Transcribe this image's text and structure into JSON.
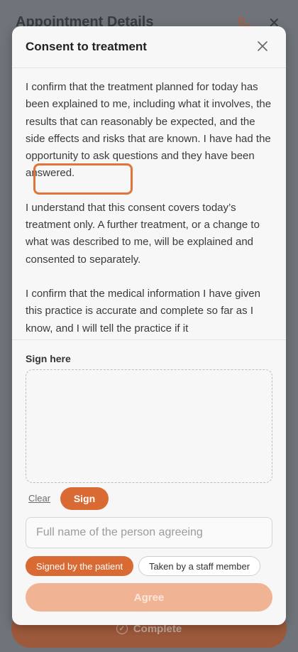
{
  "background": {
    "title": "Appointment Details",
    "complete_label": "Complete",
    "icons": {
      "phone": "phone-icon",
      "close": "close-icon",
      "check": "check-circle-icon"
    }
  },
  "modal": {
    "title": "Consent to treatment",
    "close_icon": "close-icon",
    "paragraphs": [
      "I confirm that the treatment planned for today has been explained to me, including what it involves, the results that can reasonably be expected, and the side effects and risks that are known. I have had the opportunity to ask questions and they have been answered.",
      "I understand that this consent covers today’s treatment only. A further treatment, or a change to what was described to me, will be explained and consented to separately.",
      "I confirm that the medical information I have given this practice is accurate and complete so far as I know, and I will tell the practice if it"
    ],
    "signature": {
      "label": "Sign here",
      "clear_label": "Clear",
      "sign_label": "Sign"
    },
    "name_field": {
      "placeholder": "Full name of the person agreeing",
      "value": ""
    },
    "signer_options": [
      {
        "label": "Signed by the patient",
        "selected": true
      },
      {
        "label": "Taken by a staff member",
        "selected": false
      }
    ],
    "agree_label": "Agree"
  },
  "colors": {
    "accent": "#d96a34",
    "accent_disabled": "#f0b494",
    "highlight": "#e0743a"
  }
}
